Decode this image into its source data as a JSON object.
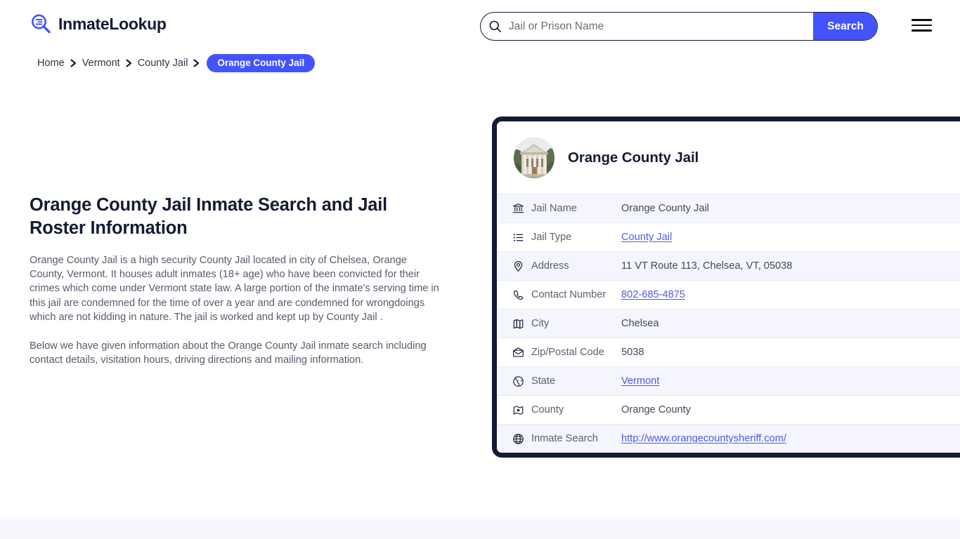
{
  "brand": {
    "name": "InmateLookup",
    "logo_icon": "magnifier-list-icon",
    "accent_color": "#4353ff",
    "dark_color": "#141b34"
  },
  "search": {
    "placeholder": "Jail or Prison Name",
    "value": "",
    "button_label": "Search",
    "icon": "search-icon"
  },
  "menu": {
    "icon": "hamburger-menu-icon"
  },
  "breadcrumb": {
    "items": [
      {
        "label": "Home",
        "current": false
      },
      {
        "label": "Vermont",
        "current": false
      },
      {
        "label": "County Jail",
        "current": false
      },
      {
        "label": "Orange County Jail",
        "current": true
      }
    ],
    "separator_icon": "chevron-right-icon"
  },
  "main": {
    "title": "Orange County Jail Inmate Search and Jail Roster Information",
    "paragraphs": [
      "Orange County Jail is a high security County Jail located in city of Chelsea, Orange County, Vermont. It houses adult inmates (18+ age) who have been convicted for their crimes which come under Vermont state law. A large portion of the inmate's serving time in this jail are condemned for the time of over a year and are condemned for wrongdoings which are not kidding in nature. The jail is worked and kept up by County Jail .",
      "Below we have given information about the Orange County Jail inmate search including contact details, visitation hours, driving directions and mailing information."
    ]
  },
  "card": {
    "title": "Orange County Jail",
    "avatar_icon": "courthouse-photo",
    "rows": [
      {
        "icon": "bank-building-icon",
        "label": "Jail Name",
        "value": "Orange County Jail",
        "link": false
      },
      {
        "icon": "list-icon",
        "label": "Jail Type",
        "value": "County Jail",
        "link": true
      },
      {
        "icon": "map-pin-icon",
        "label": "Address",
        "value": "11 VT Route 113, Chelsea, VT, 05038",
        "link": false
      },
      {
        "icon": "phone-icon",
        "label": "Contact Number",
        "value": "802-685-4875",
        "link": true
      },
      {
        "icon": "map-icon",
        "label": "City",
        "value": "Chelsea",
        "link": false
      },
      {
        "icon": "envelope-icon",
        "label": "Zip/Postal Code",
        "value": "5038",
        "link": false
      },
      {
        "icon": "globe-americas-icon",
        "label": "State",
        "value": "Vermont",
        "link": true
      },
      {
        "icon": "map-location-icon",
        "label": "County",
        "value": "Orange County",
        "link": false
      },
      {
        "icon": "globe-icon",
        "label": "Inmate Search",
        "value": "http://www.orangecountysheriff.com/",
        "link": true
      }
    ]
  }
}
